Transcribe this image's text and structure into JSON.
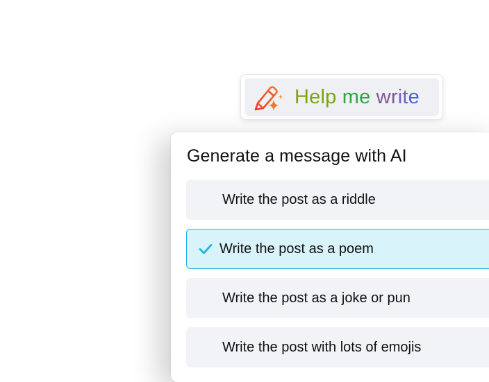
{
  "help_button": {
    "words": [
      "Help",
      "me",
      "wr",
      "it",
      "e"
    ],
    "icon": "pen-sparkle-icon",
    "colors": [
      "#7ea40f",
      "#2fa542",
      "#7b5a94",
      "#6a63c4",
      "#4f5fd8"
    ]
  },
  "panel": {
    "title": "Generate a message with AI",
    "options": [
      {
        "label": "Write the post as a riddle",
        "selected": false
      },
      {
        "label": "Write the post as a poem",
        "selected": true
      },
      {
        "label": "Write the post as a joke or pun",
        "selected": false
      },
      {
        "label": "Write the post with lots of emojis",
        "selected": false
      }
    ],
    "selected_icon": "checkmark-icon",
    "selected_color": "#22b4e8"
  }
}
